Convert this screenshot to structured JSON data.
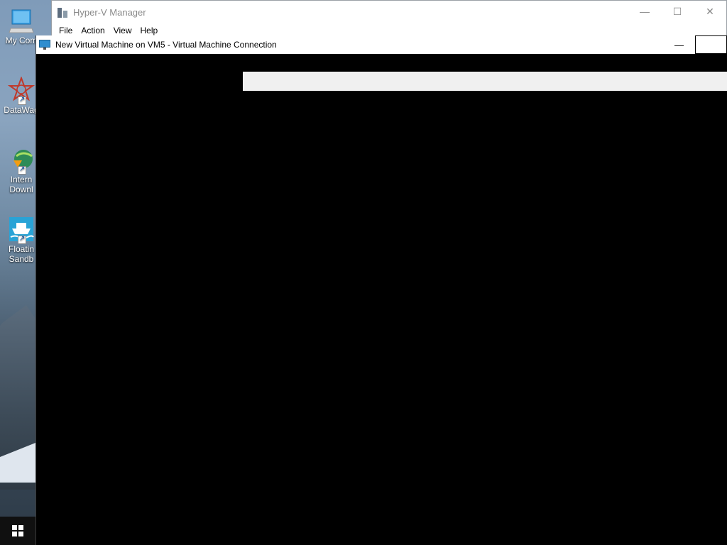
{
  "desktop": {
    "icons": [
      {
        "label": "My Com",
        "icon": "computer-icon"
      },
      {
        "label": "DataWag",
        "icon": "datawagon-icon"
      },
      {
        "label": "Intern",
        "label2": "Downl",
        "icon": "internet-download-icon"
      },
      {
        "label": "Floatin",
        "label2": "Sandb",
        "icon": "floating-sandbox-icon"
      }
    ]
  },
  "taskbar": {
    "start_icon": "windows-logo-icon"
  },
  "hyperv_manager": {
    "title": "Hyper-V Manager",
    "menu": [
      "File",
      "Action",
      "View",
      "Help"
    ],
    "controls": {
      "minimize": "—",
      "maximize": "☐",
      "close": "✕"
    }
  },
  "vm_connection": {
    "title": "New Virtual Machine on VM5 - Virtual Machine Connection",
    "controls": {
      "minimize": "—"
    },
    "screen": {
      "progress_bar_color": "#f0f0f0",
      "background": "#000000"
    }
  }
}
